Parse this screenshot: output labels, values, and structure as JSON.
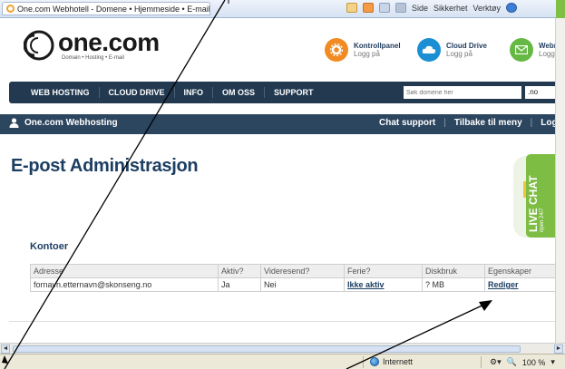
{
  "browser": {
    "tab_title": "One.com Webhotell - Domene • Hjemmeside • E-mail",
    "commands": [
      "Side",
      "Sikkerhet",
      "Verktøy"
    ],
    "status_zone": "Internett",
    "zoom": "100 %"
  },
  "header": {
    "logo_text": "one.com",
    "logo_tagline": "Domain • Hosting • E-mail",
    "links": [
      {
        "title": "Kontrollpanel",
        "sub": "Logg på",
        "icon": "gear-icon",
        "color": "#f28a22"
      },
      {
        "title": "Cloud Drive",
        "sub": "Logg på",
        "icon": "cloud-icon",
        "color": "#1b8fd3"
      },
      {
        "title": "Webmail",
        "sub": "Logg",
        "icon": "mail-icon",
        "color": "#66b845"
      }
    ]
  },
  "nav": {
    "items": [
      "WEB HOSTING",
      "CLOUD DRIVE",
      "INFO",
      "OM OSS",
      "SUPPORT"
    ],
    "search_placeholder": "Søk domene her",
    "tld": ".no"
  },
  "subbar": {
    "user_label": "One.com Webhosting",
    "links": [
      "Chat support",
      "Tilbake til meny",
      "Logg"
    ]
  },
  "main": {
    "page_title": "E-post Administrasjon",
    "section_title": "Kontoer",
    "live_chat": {
      "label": "LIVE CHAT",
      "sub": "open 24/7"
    },
    "table": {
      "headers": [
        "Adresse",
        "Aktiv?",
        "Videresend?",
        "Ferie?",
        "Diskbruk",
        "Egenskaper"
      ],
      "rows": [
        {
          "address": "fornavn.etternavn@skonseng.no",
          "active": "Ja",
          "forward": "Nei",
          "vacation": "Ikke aktiv",
          "disk": "? MB",
          "action": "Rediger"
        }
      ]
    }
  },
  "colors": {
    "navbar": "#223950",
    "subbar": "#2d4660",
    "title": "#1c3e63",
    "live_chat": "#7ebd43"
  }
}
